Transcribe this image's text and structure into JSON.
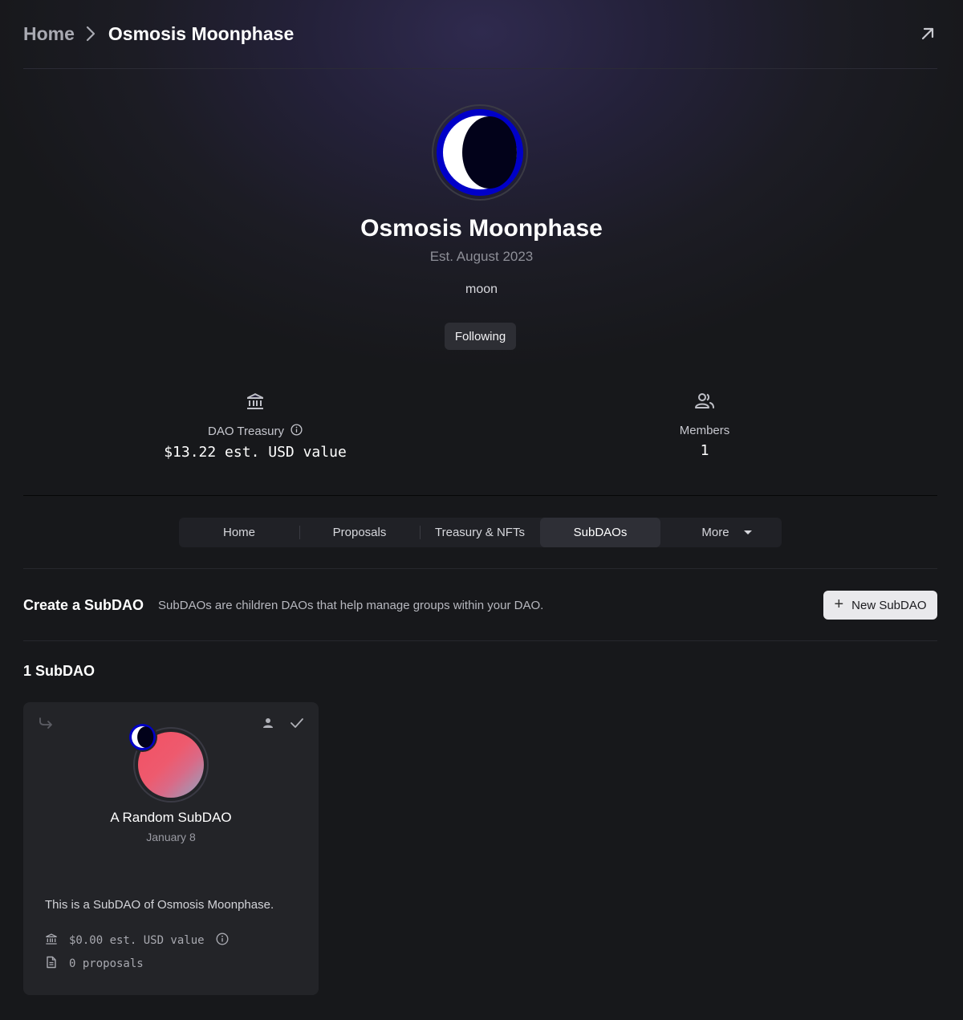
{
  "breadcrumb": {
    "home": "Home",
    "current": "Osmosis Moonphase"
  },
  "dao": {
    "name": "Osmosis Moonphase",
    "established": "Est. August 2023",
    "description": "moon",
    "follow_label": "Following"
  },
  "stats": {
    "treasury_label": "DAO Treasury",
    "treasury_value": "$13.22 est. USD value",
    "members_label": "Members",
    "members_value": "1"
  },
  "tabs": [
    {
      "label": "Home"
    },
    {
      "label": "Proposals"
    },
    {
      "label": "Treasury & NFTs"
    },
    {
      "label": "SubDAOs",
      "active": true
    },
    {
      "label": "More"
    }
  ],
  "create": {
    "title": "Create a SubDAO",
    "description": "SubDAOs are children DAOs that help manage groups within your DAO.",
    "button_label": "New SubDAO"
  },
  "subdao_count": "1 SubDAO",
  "subdaos": [
    {
      "name": "A Random SubDAO",
      "date": "January 8",
      "description": "This is a SubDAO of Osmosis Moonphase.",
      "treasury": "$0.00 est. USD value",
      "proposals": "0 proposals"
    }
  ],
  "icons": {
    "external": "external-link-icon",
    "treasury": "bank-icon",
    "members": "people-icon",
    "info": "info-icon",
    "chevron": "chevron-right-icon"
  },
  "colors": {
    "background": "#17181b",
    "accent_avatar_ring": "#0000c8",
    "button_light": "#e9e9ec"
  }
}
